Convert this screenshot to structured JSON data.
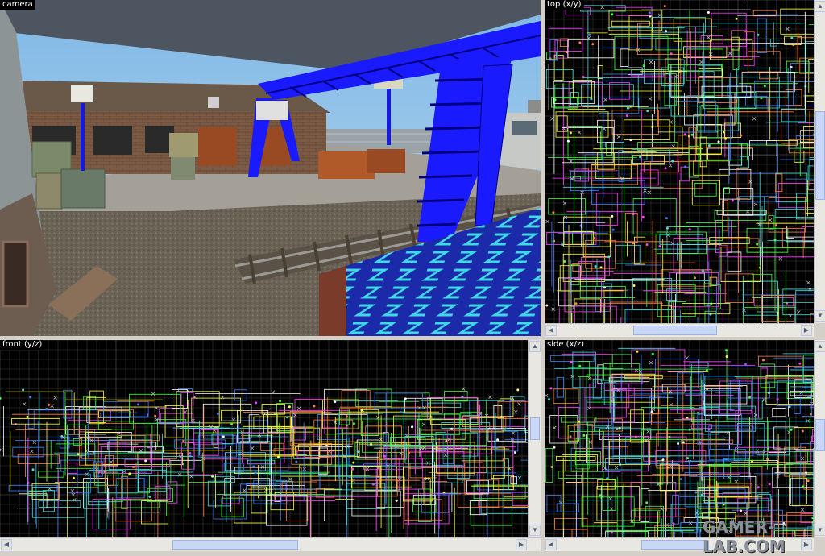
{
  "viewports": {
    "camera": {
      "label": "camera"
    },
    "top": {
      "label": "top (x/y)"
    },
    "front": {
      "label": "front (y/z)"
    },
    "side": {
      "label": "side (x/z)"
    }
  },
  "watermark": "GAMER-LAB.COM",
  "icons": {
    "scroll_left": "arrow-left-icon",
    "scroll_right": "arrow-right-icon",
    "scroll_up": "arrow-up-icon",
    "scroll_down": "arrow-down-icon"
  },
  "colors": {
    "grid": "#3a3a3a",
    "grid_major": "#5a5a5a",
    "brush_cyan": "#40e0e0",
    "brush_magenta": "#ff40ff",
    "brush_white": "#ffffff",
    "brush_green": "#40ff40",
    "brush_blue": "#4080ff",
    "crane_blue": "#1a1aff"
  }
}
